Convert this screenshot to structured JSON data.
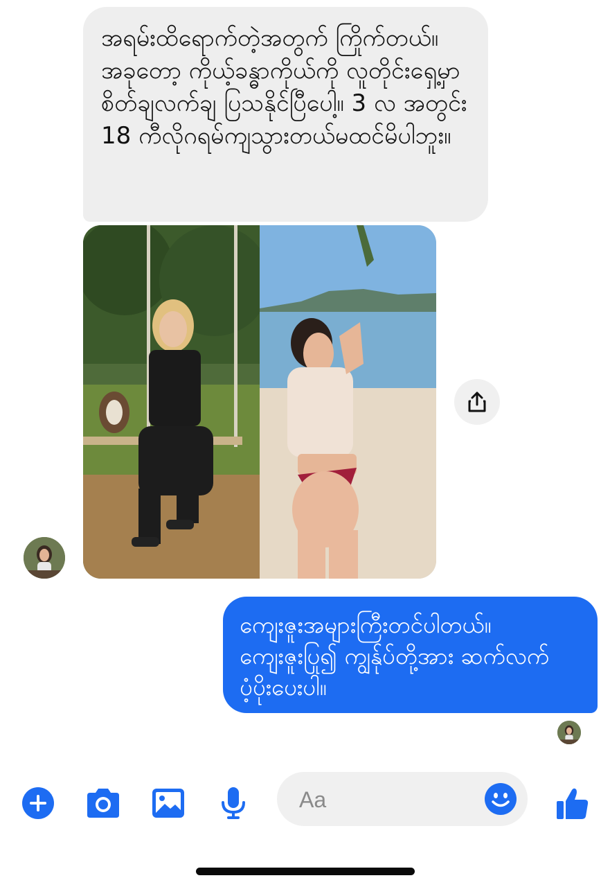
{
  "conversation": {
    "incoming_message": {
      "text": "အရမ်းထိရောက်တဲ့အတွက် ကြိုက်တယ်။ အခုတော့ ကိုယ့်ခန္ဓာကိုယ်ကို လူတိုင်းရှေ့မှာ စိတ်ချလက်ချ ပြသနိုင်ပြီပေါ့။ 3 လ အတွင်း 18 ကီလိုဂရမ်ကျသွားတယ်မထင်မိပါဘူး။"
    },
    "photo": {
      "icon": "before-after-photo"
    },
    "outgoing_message": {
      "text": "ကျေးဇူးအများကြီးတင်ပါတယ်။ ကျေးဇူးပြု၍ ကျွန်ုပ်တို့အား ဆက်လက်ပံ့ပိုးပေးပါ။"
    }
  },
  "composer": {
    "placeholder": "Aa",
    "icons": [
      "plus-icon",
      "camera-icon",
      "image-icon",
      "microphone-icon",
      "emoji-icon",
      "thumbs-up-icon"
    ]
  },
  "colors": {
    "accent": "#1d6cf2",
    "incoming_bubble": "#eeeeee",
    "pill": "#f0f0f0"
  }
}
